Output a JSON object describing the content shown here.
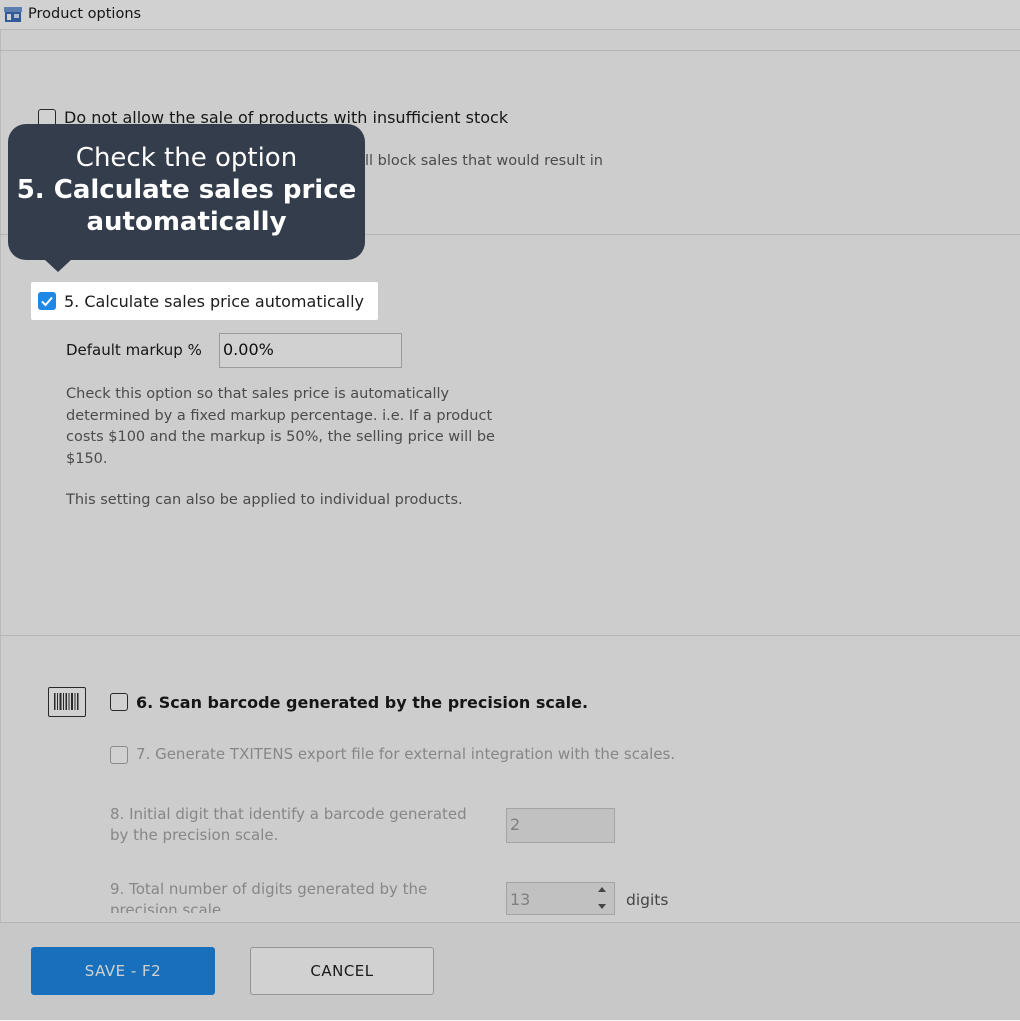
{
  "window": {
    "title": "Product options"
  },
  "stock_option": {
    "label": "Do not allow the sale of products with insufficient stock",
    "description_visible": "ll block sales that would result in",
    "checked": false
  },
  "markup_option": {
    "label": "5. Calculate sales price automatically",
    "checked": true,
    "default_markup_label": "Default markup %",
    "default_markup_value": "0.00%",
    "description_lines": [
      "Check this option so that sales price is automatically",
      "determined by a fixed markup percentage. i.e. If a product",
      "costs $100 and the markup is 50%, the selling price will be",
      "$150."
    ],
    "note": "This setting can also be applied to individual products."
  },
  "scale_section": {
    "scan_label": "6. Scan barcode generated by the precision scale.",
    "scan_checked": false,
    "export_label": "7. Generate TXITENS export file for external integration with the scales.",
    "initial_digit_label_lines": [
      "8. Initial digit that identify a barcode generated",
      "by the precision scale."
    ],
    "initial_digit_value": "2",
    "total_digits_label_lines": [
      "9. Total number of digits generated by the",
      "precision scale"
    ],
    "total_digits_value": "13",
    "total_digits_unit": "digits"
  },
  "footer": {
    "save_label": "SAVE - F2",
    "cancel_label": "CANCEL"
  },
  "tooltip": {
    "line1": "Check the option",
    "line2": "5. Calculate sales price",
    "line3": "automatically"
  },
  "colors": {
    "accent": "#1e88e5",
    "tooltip_bg": "#343d4b"
  }
}
